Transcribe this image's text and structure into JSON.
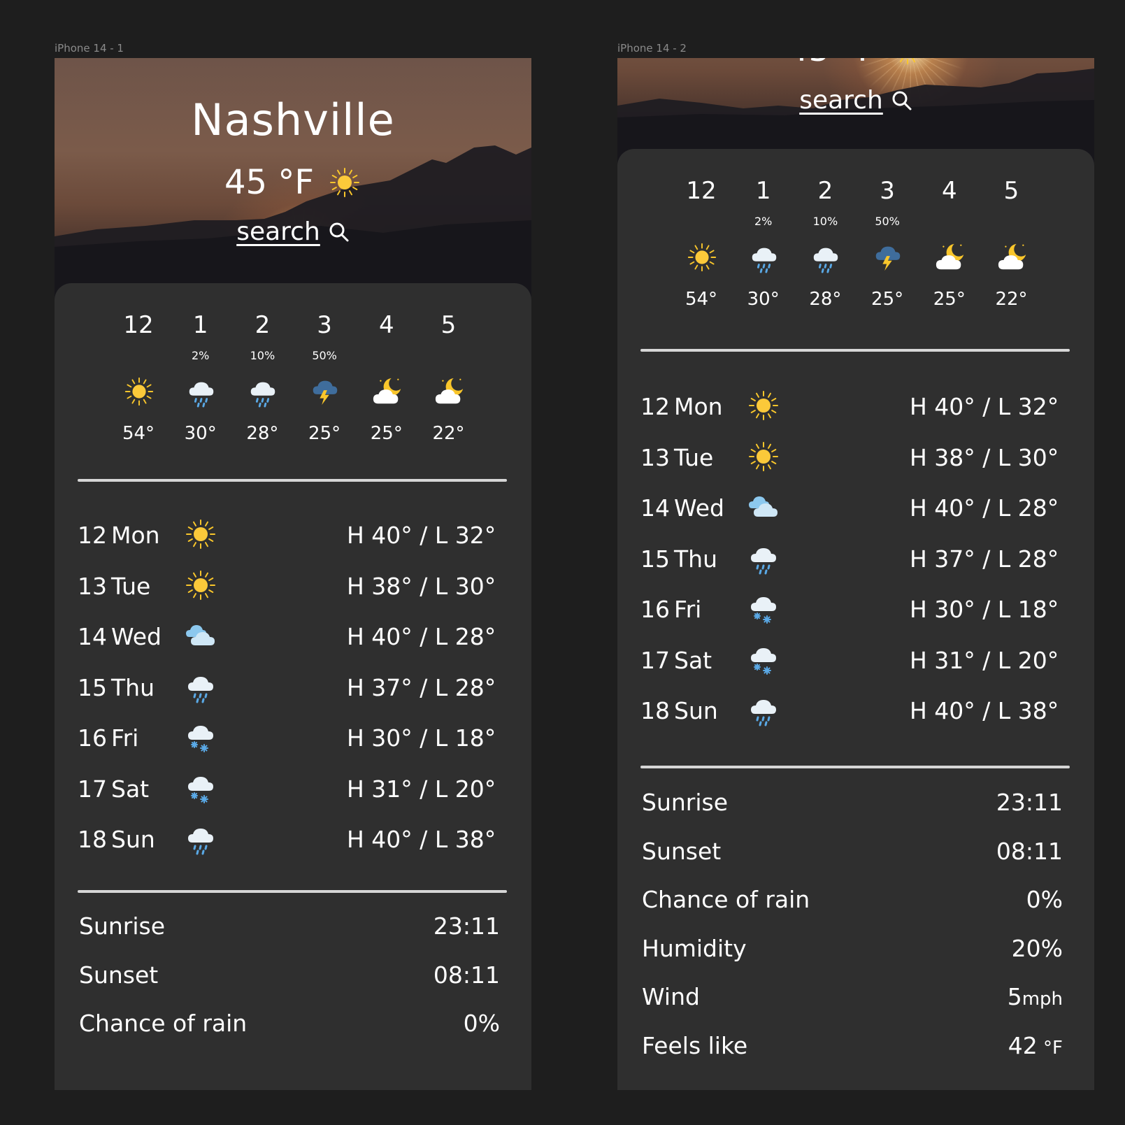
{
  "frames": [
    {
      "label": "iPhone 14 - 1"
    },
    {
      "label": "iPhone 14 - 2"
    }
  ],
  "location": {
    "city": "Nashville",
    "temperature": "45 °F",
    "condition_icon": "sun-icon"
  },
  "search": {
    "label": "search",
    "icon": "search-icon"
  },
  "hourly": [
    {
      "hour": "12",
      "precip": "",
      "icon": "sun",
      "temp": "54°"
    },
    {
      "hour": "1",
      "precip": "2%",
      "icon": "rain",
      "temp": "30°"
    },
    {
      "hour": "2",
      "precip": "10%",
      "icon": "rain",
      "temp": "28°"
    },
    {
      "hour": "3",
      "precip": "50%",
      "icon": "thunderstorm",
      "temp": "25°"
    },
    {
      "hour": "4",
      "precip": "",
      "icon": "moon-cloud",
      "temp": "25°"
    },
    {
      "hour": "5",
      "precip": "",
      "icon": "moon-cloud",
      "temp": "22°"
    }
  ],
  "daily": [
    {
      "date": "12",
      "day": "Mon",
      "icon": "sun",
      "hilo": "H 40° / L 32°"
    },
    {
      "date": "13",
      "day": "Tue",
      "icon": "sun",
      "hilo": "H 38° / L 30°"
    },
    {
      "date": "14",
      "day": "Wed",
      "icon": "clouds",
      "hilo": "H 40° / L 28°"
    },
    {
      "date": "15",
      "day": "Thu",
      "icon": "rain",
      "hilo": "H 37° / L 28°"
    },
    {
      "date": "16",
      "day": "Fri",
      "icon": "snow",
      "hilo": "H 30° / L 18°"
    },
    {
      "date": "17",
      "day": "Sat",
      "icon": "snow",
      "hilo": "H 31° / L 20°"
    },
    {
      "date": "18",
      "day": "Sun",
      "icon": "rain",
      "hilo": "H 40° / L 38°"
    }
  ],
  "details": [
    {
      "label": "Sunrise",
      "value": "23:11",
      "unit": ""
    },
    {
      "label": "Sunset",
      "value": "08:11",
      "unit": ""
    },
    {
      "label": "Chance of rain",
      "value": "0%",
      "unit": ""
    },
    {
      "label": "Humidity",
      "value": "20%",
      "unit": ""
    },
    {
      "label": "Wind",
      "value": "5",
      "unit": "mph"
    },
    {
      "label": "Feels like",
      "value": "42",
      "unit": " °F"
    }
  ],
  "colors": {
    "page_background": "#1e1e1e",
    "card_background": "#2f2f2f",
    "divider": "#d6d6d6",
    "sun": "#f9c62b",
    "cloud": "#e9f1f7",
    "rain": "#5aa9e6",
    "text": "#ffffff"
  }
}
